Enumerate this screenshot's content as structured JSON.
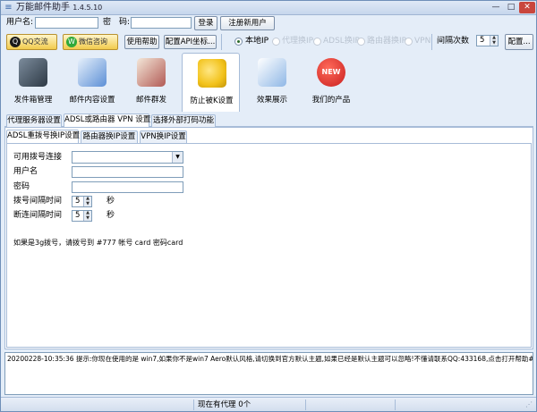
{
  "window": {
    "title": "万能邮件助手",
    "version": "1.4.5.10",
    "minimize": "—",
    "maximize": "□",
    "close": "✕"
  },
  "login": {
    "username_label": "用户名:",
    "username_value": "",
    "password_label": "密　码:",
    "password_value": "",
    "login_button": "登录",
    "register_button": "注册新用户"
  },
  "row2": {
    "qq_button": "QQ交流",
    "wechat_button": "微信咨询",
    "help_button": "使用帮助",
    "config_api_button": "配置API坐标...",
    "radios": [
      {
        "label": "本地IP",
        "selected": true,
        "enabled": true
      },
      {
        "label": "代理换IP",
        "selected": false,
        "enabled": false
      },
      {
        "label": "ADSL换IP",
        "selected": false,
        "enabled": false
      },
      {
        "label": "路由器换IP",
        "selected": false,
        "enabled": false
      },
      {
        "label": "VPN",
        "selected": false,
        "enabled": false
      }
    ],
    "interval_label": "间隔次数",
    "interval_value": "5",
    "config_button": "配置..."
  },
  "toolbar": [
    {
      "label": "发件箱管理",
      "icon": "mailbox-icon",
      "color": "#3c4a57"
    },
    {
      "label": "邮件内容设置",
      "icon": "edit-doc-icon",
      "color": "#5c8fd6"
    },
    {
      "label": "邮件群发",
      "icon": "mail-send-icon",
      "color": "#b25a55"
    },
    {
      "label": "防止被K设置",
      "icon": "wrench-icon",
      "color": "#f2c21b"
    },
    {
      "label": "效果展示",
      "icon": "pointer-icon",
      "color": "#8fb7e6"
    },
    {
      "label": "我们的产品",
      "icon": "new-badge-icon",
      "color": "#c91f1f",
      "badge": "NEW"
    }
  ],
  "tabs_outer": [
    "代理服务器设置",
    "ADSL或路由器 VPN 设置",
    "选择外部打码功能"
  ],
  "tabs_inner": [
    "ADSL重拨号换IP设置",
    "路由器换IP设置",
    "VPN换IP设置"
  ],
  "form": {
    "dial_label": "可用拨号连接",
    "dial_value": "",
    "user_label": "用户名",
    "user_value": "",
    "pwd_label": "密码",
    "pwd_value": "",
    "dial_interval_label": "拨号间隔时间",
    "dial_interval_value": "5",
    "dial_interval_unit": "秒",
    "disconnect_label": "断连间隔时间",
    "disconnect_value": "5",
    "disconnect_unit": "秒",
    "note": "如果是3g拨号，请拨号到 #777 帐号 card 密码card"
  },
  "status_log": "20200228-10:35:36  提示:你现在使用的是 win7,如果你不是win7 Aero默认风格,请切换到官方默认主题,如果已经是默认主题可以忽略!不懂请联系QQ:433168,点击打开帮助#http",
  "statusbar": {
    "proxy_text": "现在有代理 0个"
  }
}
